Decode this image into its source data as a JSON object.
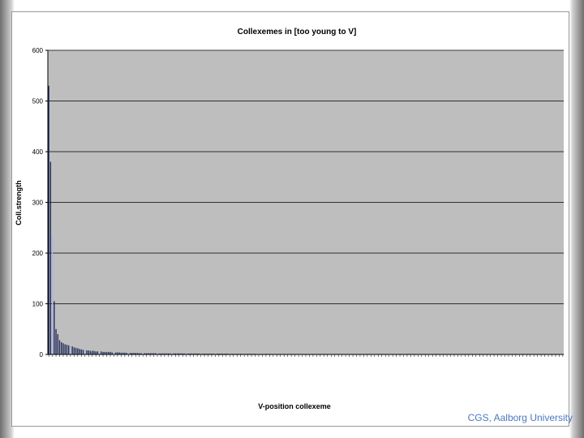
{
  "footer": {
    "text": "CGS, Aalborg University"
  },
  "colors": {
    "plot_bg": "#bebebe",
    "bar_dark": "#1f2a55",
    "bar_light": "#aab4ea",
    "gridline": "#000000"
  },
  "chart_data": {
    "type": "bar",
    "title": "Collexemes in [too young to V]",
    "xlabel": "V-position collexeme",
    "ylabel": "Coll.strength",
    "ylim": [
      0,
      600
    ],
    "yticks": [
      "0",
      "100",
      "200",
      "300",
      "400",
      "500",
      "600"
    ],
    "grid": true,
    "legend": "none",
    "series": [
      {
        "values": [
          530,
          380,
          235,
          105,
          50,
          40,
          28,
          24,
          22,
          20,
          19,
          18,
          17,
          16,
          14,
          13,
          12,
          11,
          10,
          9,
          9,
          8,
          8,
          7,
          7,
          7,
          6,
          6,
          6,
          6,
          5,
          5,
          5,
          5,
          5,
          4,
          4,
          4,
          4,
          4,
          3.5,
          3.5,
          3.5,
          3,
          3,
          3,
          3,
          3,
          3,
          3,
          2.5,
          2.5,
          2.5,
          2.5,
          2.5,
          2.5,
          2.5,
          2.5,
          2.5,
          2.5,
          2,
          2,
          2,
          2,
          2,
          2,
          2,
          2,
          2,
          2,
          2,
          2,
          2,
          2,
          2,
          1.8,
          1.8,
          1.8,
          1.8,
          1.8,
          1.8,
          1.8,
          1.8,
          1.8,
          1.8,
          1.5,
          1.5,
          1.5,
          1.5,
          1.5,
          1.5,
          1.5,
          1.5,
          1.5,
          1.5,
          1.5,
          1.5,
          1.5,
          1.5,
          1.5,
          1.2,
          1.2,
          1.2,
          1.2,
          1.2,
          1.2,
          1.2,
          1.2,
          1.2,
          1.2,
          1.2,
          1.2,
          1.2,
          1.2,
          1.2,
          1,
          1,
          1,
          1,
          1,
          1,
          1,
          1,
          1,
          1,
          1,
          1,
          1,
          1,
          1,
          1,
          1,
          1,
          1,
          1,
          0.8,
          0.8,
          0.8,
          0.8,
          0.8,
          0.8,
          0.8,
          0.8,
          0.8,
          0.8,
          0.8,
          0.8,
          0.8,
          0.8,
          0.8,
          0.8,
          0.8,
          0.8,
          0.8,
          0.8,
          0.6,
          0.6,
          0.6,
          0.6,
          0.6,
          0.6,
          0.6,
          0.6,
          0.6,
          0.6,
          0.6,
          0.6,
          0.6,
          0.6,
          0.6,
          0.6,
          0.6,
          0.6,
          0.6,
          0.6,
          0.5,
          0.5,
          0.5,
          0.5,
          0.5,
          0.5,
          0.5,
          0.5,
          0.5,
          0.5,
          0.5,
          0.5,
          0.5,
          0.5,
          0.5,
          0.5,
          0.5,
          0.5,
          0.5,
          0.5,
          0.4,
          0.4,
          0.4,
          0.4,
          0.4,
          0.4,
          0.4,
          0.4,
          0.4,
          0.4,
          0.4,
          0.4,
          0.4,
          0.4,
          0.4,
          0.4,
          0.4,
          0.4,
          0.4,
          0.4,
          0.3,
          0.3,
          0.3,
          0.3,
          0.3,
          0.3,
          0.3,
          0.3,
          0.3,
          0.3,
          0.3,
          0.3,
          0.3,
          0.3,
          0.3,
          0.3,
          0.3,
          0.3,
          0.3,
          0.3,
          0.3,
          0.3,
          0.3,
          0.3,
          0.3,
          0.3,
          0.3,
          0.3,
          0.3,
          0.3,
          0.2,
          0.2,
          0.2,
          0.2,
          0.2,
          0.2,
          0.2,
          0.2,
          0.2,
          0.2,
          0.2,
          0.2,
          0.2,
          0.2,
          0.2,
          0.2,
          0.2,
          0.2,
          0.2,
          0.2,
          0.2,
          0.2,
          0.2,
          0.2,
          0.2,
          0.2,
          0.2,
          0.2,
          0.2,
          0.2,
          0.2,
          0.2,
          0.2,
          0.2,
          0.2,
          0.2,
          0.2,
          0.2,
          0.2,
          0.2
        ],
        "light_indices": [
          2,
          12,
          20,
          28,
          36,
          44,
          52,
          60,
          68,
          76,
          84,
          92,
          100,
          108,
          116,
          124,
          132,
          140,
          148,
          156,
          164,
          172,
          180,
          188,
          196,
          204,
          212,
          220,
          228,
          236,
          244,
          252,
          260,
          268,
          276,
          284,
          292
        ]
      }
    ]
  }
}
